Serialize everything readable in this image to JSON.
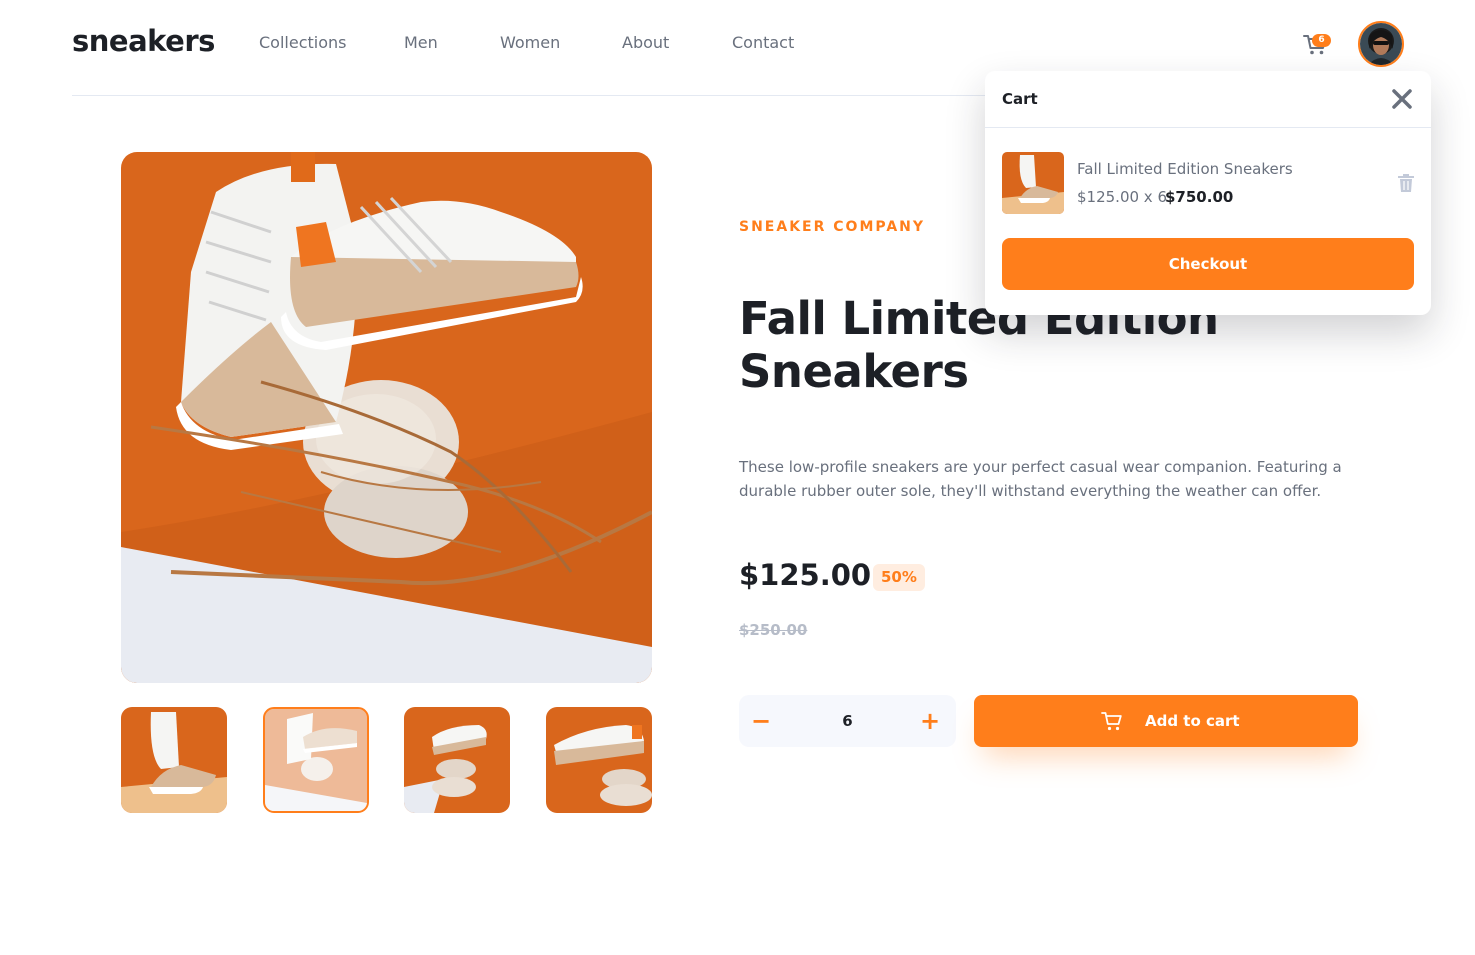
{
  "header": {
    "logo": "sneakers",
    "nav": [
      "Collections",
      "Men",
      "Women",
      "About",
      "Contact"
    ],
    "cart_count": "6"
  },
  "gallery": {
    "thumbnails_count": 4,
    "active_thumbnail": 2
  },
  "product": {
    "company": "SNEAKER COMPANY",
    "title": "Fall Limited Edition Sneakers",
    "description": "These low-profile sneakers are your perfect casual wear companion. Featuring a durable rubber outer sole, they'll withstand everything the weather can offer.",
    "price": "$125.00",
    "discount": "50%",
    "old_price": "$250.00",
    "quantity": "6",
    "minus_label": "−",
    "plus_label": "+",
    "add_to_cart": "Add to cart"
  },
  "cart": {
    "title": "Cart",
    "item_name": "Fall Limited Edition Sneakers",
    "item_calc": "$125.00 x 6",
    "item_total": "$750.00",
    "checkout": "Checkout"
  },
  "colors": {
    "accent": "#ff7e1b",
    "pale_accent": "#ffede0",
    "text_dark": "#1d2026",
    "text_gray": "#69707d",
    "light_bg": "#f6f8fd"
  }
}
